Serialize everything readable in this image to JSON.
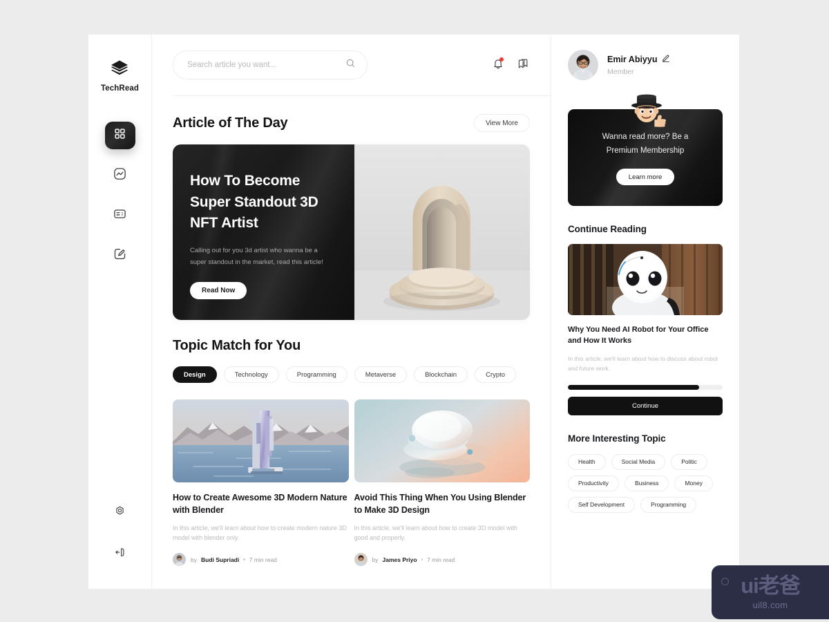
{
  "brand": {
    "name": "TechRead",
    "logo_icon": "layers-stack-icon"
  },
  "rail": {
    "items": [
      {
        "name": "dashboard",
        "icon": "grid-dashboard-icon",
        "active": true
      },
      {
        "name": "trending",
        "icon": "activity-chart-icon",
        "active": false
      },
      {
        "name": "articles",
        "icon": "news-card-icon",
        "active": false
      },
      {
        "name": "write",
        "icon": "edit-pencil-square-icon",
        "active": false
      }
    ],
    "bottom": [
      {
        "name": "settings",
        "icon": "gear-icon"
      },
      {
        "name": "logout",
        "icon": "logout-arrow-icon"
      }
    ]
  },
  "topbar": {
    "search": {
      "placeholder": "Search article you want...",
      "value": "",
      "icon": "search-icon"
    },
    "notification_icon": "bell-icon",
    "notification_has_badge": true,
    "bookmark_icon": "bookmark-stack-icon"
  },
  "article_of_the_day": {
    "heading": "Article of The Day",
    "view_more_label": "View More",
    "hero": {
      "title": "How To Become Super Standout 3D NFT Artist",
      "description": "Calling out for you 3d artist who wanna be a super standout in the market, read this article!",
      "cta_label": "Read Now",
      "image_alt": "beige-3d-arch-podium"
    }
  },
  "topic_match": {
    "heading": "Topic Match for You",
    "tabs": [
      {
        "label": "Design",
        "active": true
      },
      {
        "label": "Technology",
        "active": false
      },
      {
        "label": "Programming",
        "active": false
      },
      {
        "label": "Metaverse",
        "active": false
      },
      {
        "label": "Blockchain",
        "active": false
      },
      {
        "label": "Crypto",
        "active": false
      }
    ],
    "articles": [
      {
        "title": "How to Create Awesome 3D Modern Nature with Blender",
        "description": "In this article, we'll learn about how to create modern nature 3D model with blender only.",
        "author_prefix": "by",
        "author": "Budi Supriadi",
        "read_time": "7 min read",
        "image_alt": "3d-mountain-lake-monolith"
      },
      {
        "title": "Avoid This Thing When You Using Blender to Make 3D Design",
        "description": "In this article, we'll learn about how to create 3D model with good and properly.",
        "author_prefix": "by",
        "author": "James Priyo",
        "read_time": "7 min read",
        "image_alt": "3d-abstract-discs-gradient"
      }
    ]
  },
  "profile": {
    "name": "Emir Abiyyu",
    "role": "Member",
    "edit_icon": "edit-pencil-icon",
    "avatar_alt": "user-photo"
  },
  "promo": {
    "text": "Wanna read more? Be a Premium Membership",
    "cta_label": "Learn more",
    "mascot_alt": "memoji-top-hat-thumbs-up"
  },
  "continue_reading": {
    "heading": "Continue Reading",
    "title": "Why You Need AI Robot for Your Office and How It Works",
    "description": "In this article, we'll learn about how to discuss about robot and future work.",
    "progress_percent": 85,
    "cta_label": "Continue",
    "image_alt": "white-humanoid-robot"
  },
  "more_topics": {
    "heading": "More Interesting Topic",
    "tags": [
      "Health",
      "Social Media",
      "Politic",
      "Productivity",
      "Business",
      "Money",
      "Self Development",
      "Programming"
    ]
  },
  "watermark": {
    "main": "ui老爸",
    "sub": "uil8.com"
  },
  "colors": {
    "page_background": "#ececec",
    "surface": "#ffffff",
    "ink": "#15171a",
    "muted": "#bcbcbc",
    "accent_dark": "#111111",
    "notification_red": "#f03a2f",
    "watermark_bg": "#2b2e45"
  }
}
